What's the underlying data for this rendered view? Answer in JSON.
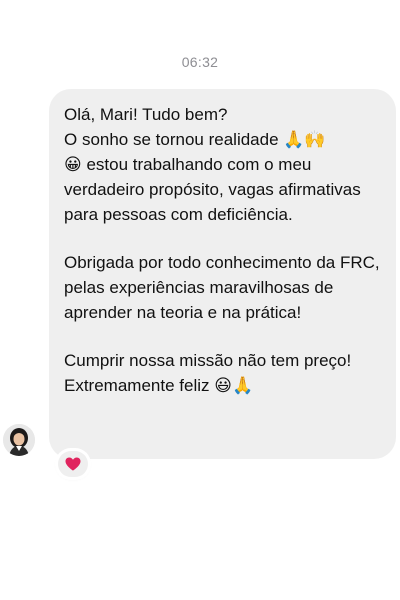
{
  "conversation": {
    "timestamp": "06:32",
    "message": {
      "paragraphs": [
        "Olá, Mari! Tudo bem?\nO sonho se tornou realidade 🙏🙌\n😀 estou trabalhando com o meu verdadeiro propósito, vagas afirmativas para pessoas com deficiência.",
        "Obrigada por todo conhecimento da FRC, pelas experiências maravilhosas de aprender na teoria e na prática!",
        "Cumprir nossa missão não tem preço! Extremamente feliz 😃🙏"
      ],
      "reaction": "heart-icon",
      "reaction_color": "#e0245e"
    },
    "sender_avatar": "avatar",
    "bubble_color": "#efefef"
  }
}
